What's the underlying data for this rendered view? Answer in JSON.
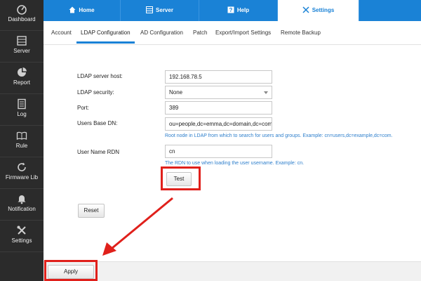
{
  "sidebar": {
    "items": [
      {
        "label": "Dashboard",
        "icon": "gauge-icon"
      },
      {
        "label": "Server",
        "icon": "server-icon"
      },
      {
        "label": "Report",
        "icon": "pie-chart-icon"
      },
      {
        "label": "Log",
        "icon": "document-icon"
      },
      {
        "label": "Rule",
        "icon": "book-icon"
      },
      {
        "label": "Firmware Lib",
        "icon": "refresh-icon"
      },
      {
        "label": "Notification",
        "icon": "bell-icon"
      },
      {
        "label": "Settings",
        "icon": "tools-icon"
      }
    ]
  },
  "top_tabs": [
    {
      "label": "Home",
      "icon": "home-icon"
    },
    {
      "label": "Server",
      "icon": "server-icon"
    },
    {
      "label": "Help",
      "icon": "help-icon"
    },
    {
      "label": "Settings",
      "icon": "tools-icon",
      "active": true
    }
  ],
  "sub_tabs": [
    {
      "label": "Account"
    },
    {
      "label": "LDAP Configuration",
      "active": true
    },
    {
      "label": "AD Configuration"
    },
    {
      "label": "Patch"
    },
    {
      "label": "Export/Import Settings"
    },
    {
      "label": "Remote Backup"
    }
  ],
  "form": {
    "host": {
      "label": "LDAP server host:",
      "value": "192.168.78.5"
    },
    "security": {
      "label": "LDAP security:",
      "value": "None"
    },
    "port": {
      "label": "Port:",
      "value": "389"
    },
    "base_dn": {
      "label": "Users Base DN:",
      "value": "ou=people,dc=emma,dc=domain,dc=com",
      "hint": "Root node in LDAP from which to search for users and groups. Example: cn=users,dc=example,dc=com."
    },
    "rdn": {
      "label": "User Name RDN",
      "value": "cn",
      "hint": "The RDN to use when loading the user username. Example: cn."
    }
  },
  "buttons": {
    "test": "Test",
    "reset": "Reset",
    "apply": "Apply"
  },
  "colors": {
    "accent": "#1a82d6",
    "sidebar": "#2b2b2b",
    "highlight": "#e0201b",
    "hint": "#2e7fcc"
  }
}
